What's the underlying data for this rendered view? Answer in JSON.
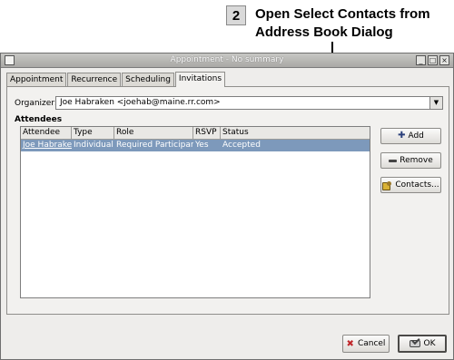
{
  "callout": {
    "step": "2",
    "line1": "Open Select Contacts from",
    "line2": "Address Book Dialog"
  },
  "window": {
    "title": "Appointment - No summary",
    "minimize_glyph": "_",
    "maximize_glyph": "□",
    "close_glyph": "×"
  },
  "tabs": [
    {
      "label": "Appointment"
    },
    {
      "label": "Recurrence"
    },
    {
      "label": "Scheduling"
    },
    {
      "label": "Invitations"
    }
  ],
  "organizer": {
    "label": "Organizer:",
    "value": "Joe Habraken <joehab@maine.rr.com>",
    "dropdown_glyph": "▼"
  },
  "attendees": {
    "label": "Attendees",
    "columns": [
      "Attendee",
      "Type",
      "Role",
      "RSVP",
      "Status"
    ],
    "rows": [
      [
        "Joe Habraken",
        "Individual",
        "Required Participant",
        "Yes",
        "Accepted"
      ]
    ]
  },
  "buttons": {
    "add": "Add",
    "remove": "Remove",
    "contacts": "Contacts...",
    "cancel": "Cancel",
    "ok": "OK",
    "plus_glyph": "✚",
    "x_glyph": "✖"
  },
  "icons": {
    "add": "plus-icon",
    "remove": "minus-icon",
    "contacts": "address-book-icon",
    "cancel": "cancel-x-icon",
    "ok": "ok-check-icon"
  },
  "colors": {
    "selection": "#7d99bb",
    "dialog_bg": "#eeedeb",
    "titlebar": "#a9a8a5"
  }
}
